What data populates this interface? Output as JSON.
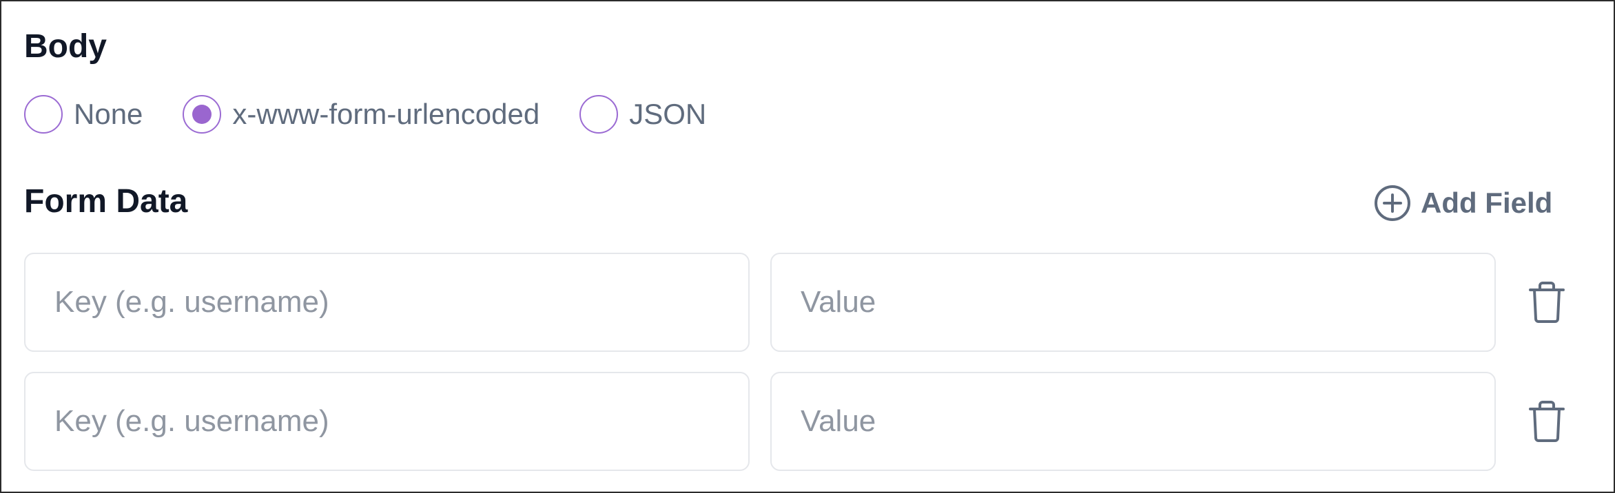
{
  "body_section": {
    "title": "Body",
    "options": [
      {
        "label": "None",
        "selected": false
      },
      {
        "label": "x-www-form-urlencoded",
        "selected": true
      },
      {
        "label": "JSON",
        "selected": false
      }
    ]
  },
  "form_data": {
    "title": "Form Data",
    "add_field_label": "Add Field",
    "rows": [
      {
        "key_placeholder": "Key (e.g. username)",
        "key_value": "",
        "value_placeholder": "Value",
        "value_value": ""
      },
      {
        "key_placeholder": "Key (e.g. username)",
        "key_value": "",
        "value_placeholder": "Value",
        "value_value": ""
      }
    ]
  },
  "icons": {
    "add": "plus-circle-icon",
    "delete": "trash-icon"
  },
  "colors": {
    "accent": "#9a66cf",
    "heading": "#111827",
    "muted_text": "#5f6b7d",
    "placeholder": "#8f96a1",
    "input_border": "#e5e7eb"
  }
}
